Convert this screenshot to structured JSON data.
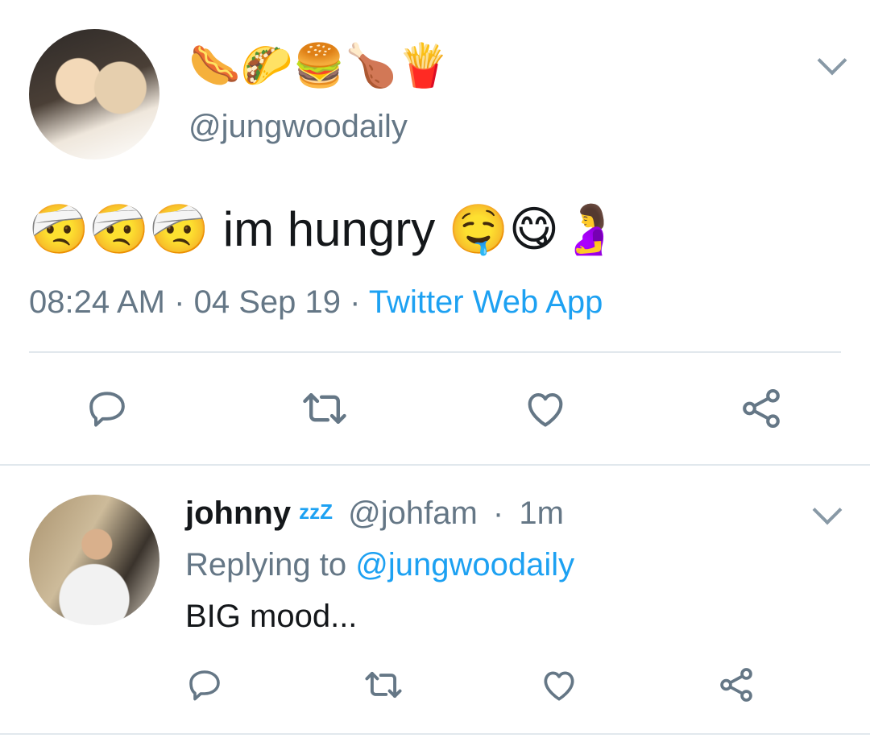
{
  "main_tweet": {
    "name_emojis": "🌭🌮🍔🍗🍟",
    "handle": "@jungwoodaily",
    "text_emoji_lead": "🤕🤕🤕",
    "text": "im hungry",
    "text_emoji_trail": "🤤😋🤰",
    "time": "08:24 AM",
    "separator": "·",
    "date": "04 Sep 19",
    "source": "Twitter Web App"
  },
  "reply_tweet": {
    "display_name": "johnny",
    "name_emoji": "zzZ",
    "handle": "@johfam",
    "separator": "·",
    "age": "1m",
    "replying_prefix": "Replying to",
    "replying_handle": "@jungwoodaily",
    "text": "BIG mood..."
  },
  "colors": {
    "accent": "#1da1f2",
    "secondary_text": "#657786",
    "icon": "#657786",
    "divider": "#e1e8ed"
  },
  "icons": [
    "chevron-down-icon",
    "reply-icon",
    "retweet-icon",
    "like-icon",
    "share-icon"
  ]
}
